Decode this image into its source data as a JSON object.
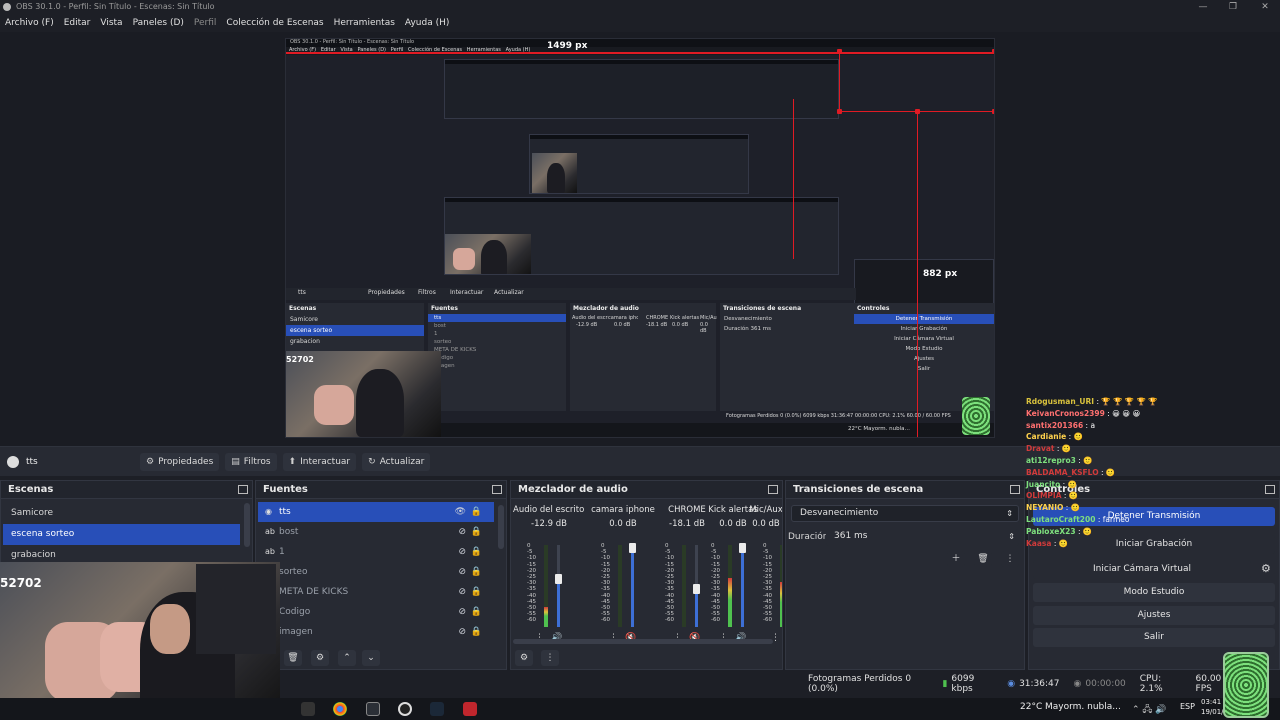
{
  "window": {
    "title": "OBS 30.1.0 - Perfil: Sin Título - Escenas: Sin Título",
    "min": "—",
    "max": "❐",
    "close": "✕"
  },
  "menu": [
    {
      "label": "Archivo (F)",
      "dim": false
    },
    {
      "label": "Editar",
      "dim": false
    },
    {
      "label": "Vista",
      "dim": false
    },
    {
      "label": "Paneles (D)",
      "dim": false
    },
    {
      "label": "Perfil",
      "dim": true
    },
    {
      "label": "Colección de Escenas",
      "dim": false
    },
    {
      "label": "Herramientas",
      "dim": false
    },
    {
      "label": "Ayuda (H)",
      "dim": false
    }
  ],
  "preview": {
    "width_label": "1499 px",
    "height_label": "882 px",
    "webcam_counter": "52702",
    "nested_title": "OBS 30.1.0 - Perfil: Sin Título - Escenas: Sin Título",
    "nested_menu": "Archivo (F)   Editar   Vista   Paneles (D)   Perfil   Colección de Escenas   Herramientas   Ayuda (H)",
    "nested": {
      "source": "tts",
      "toolbar": [
        "Propiedades",
        "Filtros",
        "Interactuar",
        "Actualizar"
      ],
      "scenes_title": "Escenas",
      "scenes": [
        "Samicore",
        "escena sorteo",
        "grabacion"
      ],
      "sources_title": "Fuentes",
      "sources": [
        "tts",
        "bost",
        "1",
        "sorteo",
        "META DE KICKS",
        "Codigo",
        "imagen"
      ],
      "mixer_title": "Mezclador de audio",
      "channels": [
        "Audio del escritorio",
        "camara iphone",
        "CHROME",
        "Kick alertas",
        "Mic/Au"
      ],
      "dbs": [
        "-12.9 dB",
        "0.0 dB",
        "-18.1 dB",
        "0.0 dB",
        "0.0 dB"
      ],
      "transitions_title": "Transiciones de escena",
      "transition": "Desvanecimiento",
      "duration_label": "Duración",
      "duration": "361 ms",
      "controls_title": "Controles",
      "controls": [
        "Detener Transmisión",
        "Iniciar Grabación",
        "Iniciar Cámara Virtual",
        "Modo Estudio",
        "Ajustes",
        "Salir"
      ],
      "status": "Fotogramas Perdidos 0 (0.0%)   6099 kbps   31:36:47   00:00:00   CPU: 2.1%   60.00 / 60.00 FPS",
      "weather": "22°C  Mayorm. nubla…"
    }
  },
  "source_bar": {
    "source_name": "tts",
    "properties": "Propiedades",
    "filters": "Filtros",
    "interact": "Interactuar",
    "refresh": "Actualizar"
  },
  "scenes": {
    "title": "Escenas",
    "items": [
      "Samicore",
      "escena sorteo",
      "grabacion"
    ],
    "selected": 1
  },
  "sources": {
    "title": "Fuentes",
    "items": [
      {
        "icon": "tts-icon",
        "label": "tts",
        "selected": true
      },
      {
        "icon": "text-icon",
        "label": "bost",
        "selected": false
      },
      {
        "icon": "text-icon",
        "label": "1",
        "selected": false
      },
      {
        "icon": "image-icon",
        "label": "sorteo",
        "selected": false
      },
      {
        "icon": "browser-icon",
        "label": "META DE KICKS",
        "selected": false
      },
      {
        "icon": "text-icon",
        "label": "Codigo",
        "selected": false
      },
      {
        "icon": "image-icon",
        "label": "imagen",
        "selected": false
      }
    ]
  },
  "mixer": {
    "title": "Mezclador de audio",
    "channels": [
      {
        "name": "Audio del escritorio",
        "db": "-12.9 dB",
        "meter": 0.25,
        "fader": 0.62,
        "muted": false
      },
      {
        "name": "camara iphone",
        "db": "0.0 dB",
        "meter": 0.0,
        "fader": 1.0,
        "muted": true
      },
      {
        "name": "CHROME",
        "db": "-18.1 dB",
        "meter": 0.0,
        "fader": 0.5,
        "muted": true
      },
      {
        "name": "Kick alertas",
        "db": "0.0 dB",
        "meter": 0.6,
        "fader": 1.0,
        "muted": false
      },
      {
        "name": "Mic/Aux",
        "db": "0.0 dB",
        "meter": 0.55,
        "fader": 1.0,
        "muted": false
      }
    ],
    "ticks": [
      "0",
      "-5",
      "-10",
      "-15",
      "-20",
      "-25",
      "-30",
      "-35",
      "-40",
      "-45",
      "-50",
      "-55",
      "-60"
    ]
  },
  "transitions": {
    "title": "Transiciones de escena",
    "selected": "Desvanecimiento",
    "duration_label": "Duración",
    "duration": "361 ms"
  },
  "controls": {
    "title": "Controles",
    "stream": "Detener Transmisión",
    "record": "Iniciar Grabación",
    "virtual_cam": "Iniciar Cámara Virtual",
    "studio": "Modo Estudio",
    "settings": "Ajustes",
    "exit": "Salir"
  },
  "chat": [
    {
      "user": "Rdogusman_URI",
      "msg": "🏆 🏆 🏆 🏆 🏆",
      "color": "#d9c23d"
    },
    {
      "user": "KeivanCronos2399",
      "msg": "😀 😀 😀",
      "color": "#ff7070"
    },
    {
      "user": "santix201366",
      "msg": "a",
      "color": "#ff7070"
    },
    {
      "user": "Cardianie",
      "msg": "🙂",
      "color": "#ffd24d"
    },
    {
      "user": "Dravat",
      "msg": "🙂",
      "color": "#d23b3b"
    },
    {
      "user": "ati12repro3",
      "msg": "🙂",
      "color": "#7ee07e"
    },
    {
      "user": "BALDAMA_KSFLO",
      "msg": "🙂",
      "color": "#d23b3b"
    },
    {
      "user": "Juancito",
      "msg": "🙂",
      "color": "#7ee07e"
    },
    {
      "user": "OLIMPIA",
      "msg": "🙂",
      "color": "#d23b3b"
    },
    {
      "user": "NEYANIO",
      "msg": "🙂",
      "color": "#ffd24d"
    },
    {
      "user": "LautaroCraft200",
      "msg": "farmeo",
      "color": "#7ee07e"
    },
    {
      "user": "PabloxeX23",
      "msg": "🙂",
      "color": "#7ee07e"
    },
    {
      "user": "Kaasa",
      "msg": "🙂",
      "color": "#d23b3b"
    }
  ],
  "webcam_counter": "52702",
  "status": {
    "dropped": "Fotogramas Perdidos 0 (0.0%)",
    "kbps": "6099 kbps",
    "live_time": "31:36:47",
    "rec_time": "00:00:00",
    "cpu": "CPU: 2.1%",
    "fps": "60.00 / 60.00 FPS"
  },
  "taskbar": {
    "weather": "22°C",
    "weather_desc": "Mayorm. nubla...",
    "lang": "ESP",
    "time": "03:41",
    "date": "19/01/2024"
  },
  "colors": {
    "accent": "#284fb8",
    "guides": "#e01b24",
    "panel": "#272a33",
    "background": "#1d1f26"
  }
}
